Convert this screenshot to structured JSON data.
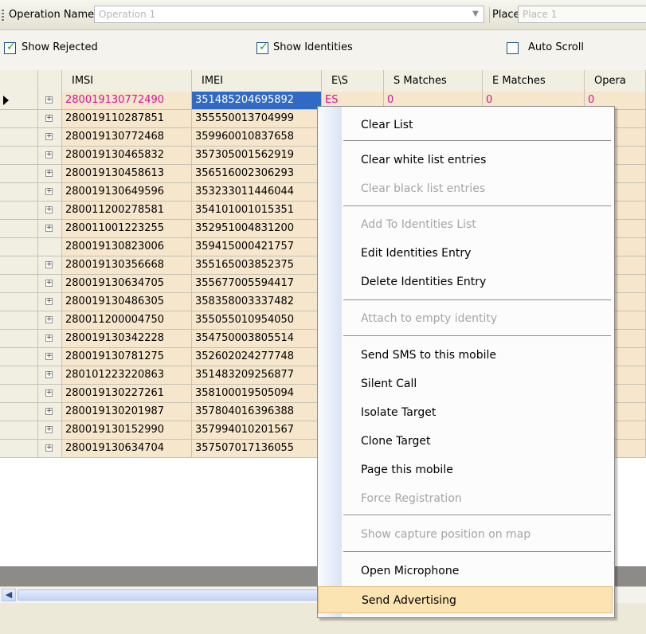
{
  "toolbar": {
    "operation_label": "Operation Name:",
    "operation_value": "Operation 1",
    "place_label": "Place:",
    "place_value": "Place 1"
  },
  "filters": {
    "show_rejected": {
      "label": "Show Rejected",
      "checked": true
    },
    "show_identities": {
      "label": "Show Identities",
      "checked": true
    },
    "auto_scroll": {
      "label": "Auto Scroll",
      "checked": false
    }
  },
  "grid": {
    "columns": [
      "IMSI",
      "IMEI",
      "E\\S",
      "S Matches",
      "E Matches",
      "Opera"
    ],
    "first_row": {
      "es": "ES",
      "s_matches": "0",
      "e_matches": "0",
      "op": "0"
    },
    "other_rows_op": "0",
    "rows": [
      {
        "imsi": "280019130772490",
        "imei": "351485204695892",
        "expand": true
      },
      {
        "imsi": "280019110287851",
        "imei": "355550013704999",
        "expand": true
      },
      {
        "imsi": "280019130772468",
        "imei": "359960010837658",
        "expand": true
      },
      {
        "imsi": "280019130465832",
        "imei": "357305001562919",
        "expand": true
      },
      {
        "imsi": "280019130458613",
        "imei": "356516002306293",
        "expand": true
      },
      {
        "imsi": "280019130649596",
        "imei": "353233011446044",
        "expand": true
      },
      {
        "imsi": "280011200278581",
        "imei": "354101001015351",
        "expand": true
      },
      {
        "imsi": "280011001223255",
        "imei": "352951004831200",
        "expand": true
      },
      {
        "imsi": "280019130823006",
        "imei": "359415000421757",
        "expand": false
      },
      {
        "imsi": "280019130356668",
        "imei": "355165003852375",
        "expand": true
      },
      {
        "imsi": "280019130634705",
        "imei": "355677005594417",
        "expand": true
      },
      {
        "imsi": "280019130486305",
        "imei": "358358003337482",
        "expand": true
      },
      {
        "imsi": "280011200004750",
        "imei": "355055010954050",
        "expand": true
      },
      {
        "imsi": "280019130342228",
        "imei": "354750003805514",
        "expand": true
      },
      {
        "imsi": "280019130781275",
        "imei": "352602024277748",
        "expand": true
      },
      {
        "imsi": "280101223220863",
        "imei": "351483209256877",
        "expand": true
      },
      {
        "imsi": "280019130227261",
        "imei": "358100019505094",
        "expand": true
      },
      {
        "imsi": "280019130201987",
        "imei": "357804016396388",
        "expand": true
      },
      {
        "imsi": "280019130152990",
        "imei": "357994010201567",
        "expand": true
      },
      {
        "imsi": "280019130634704",
        "imei": "357507017136055",
        "expand": true
      }
    ]
  },
  "context_menu": {
    "items": [
      {
        "label": "Clear List",
        "disabled": false
      },
      {
        "sep": true
      },
      {
        "label": "Clear white list entries",
        "disabled": false
      },
      {
        "label": "Clear black list entries",
        "disabled": true
      },
      {
        "sep": true
      },
      {
        "label": "Add To Identities List",
        "disabled": true
      },
      {
        "label": "Edit Identities Entry",
        "disabled": false
      },
      {
        "label": "Delete Identities Entry",
        "disabled": false
      },
      {
        "sep": true
      },
      {
        "label": "Attach to empty identity",
        "disabled": true
      },
      {
        "sep": true
      },
      {
        "label": "Send SMS to this mobile",
        "disabled": false
      },
      {
        "label": "Silent Call",
        "disabled": false
      },
      {
        "label": "Isolate Target",
        "disabled": false
      },
      {
        "label": "Clone Target",
        "disabled": false
      },
      {
        "label": "Page this mobile",
        "disabled": false
      },
      {
        "label": "Force Registration",
        "disabled": true
      },
      {
        "sep": true
      },
      {
        "label": "Show capture position on map",
        "disabled": true
      },
      {
        "sep": true
      },
      {
        "label": "Open Microphone",
        "disabled": false
      },
      {
        "label": "Send Advertising",
        "disabled": false,
        "highlighted": true
      }
    ]
  },
  "colors": {
    "row_bg": "#f5e6cc",
    "selection": "#316ac5",
    "imsi_first_row": "#d4149d",
    "menu_highlight": "#fbe3b2"
  }
}
